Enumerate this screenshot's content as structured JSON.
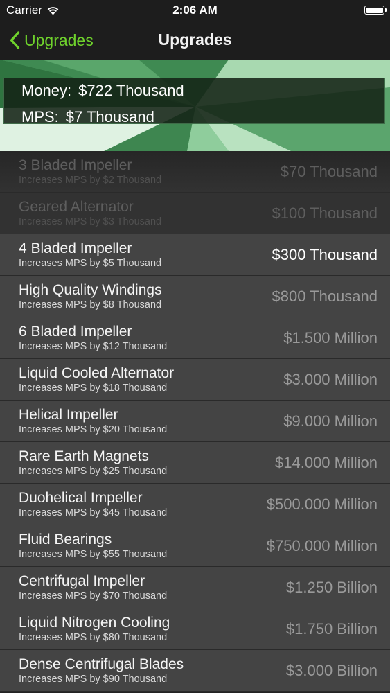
{
  "status_bar": {
    "carrier": "Carrier",
    "time": "2:06 AM",
    "icons": [
      "wifi-icon",
      "battery-icon"
    ]
  },
  "nav": {
    "back_label": "Upgrades",
    "title": "Upgrades",
    "accent_color": "#6fd22c"
  },
  "stats": {
    "money_label": "Money:",
    "money_value": "$722 Thousand",
    "mps_label": "MPS:",
    "mps_value": "$7 Thousand"
  },
  "upgrades": [
    {
      "name": "3 Bladed Impeller",
      "desc": "Increases MPS by $2 Thousand",
      "price": "$70 Thousand",
      "state": "purchased"
    },
    {
      "name": "Geared Alternator",
      "desc": "Increases MPS by $3 Thousand",
      "price": "$100 Thousand",
      "state": "purchased"
    },
    {
      "name": "4 Bladed Impeller",
      "desc": "Increases MPS by $5 Thousand",
      "price": "$300 Thousand",
      "state": "affordable"
    },
    {
      "name": "High Quality Windings",
      "desc": "Increases MPS by $8 Thousand",
      "price": "$800 Thousand",
      "state": "locked"
    },
    {
      "name": "6 Bladed Impeller",
      "desc": "Increases MPS by $12 Thousand",
      "price": "$1.500 Million",
      "state": "locked"
    },
    {
      "name": "Liquid Cooled Alternator",
      "desc": "Increases MPS by $18 Thousand",
      "price": "$3.000 Million",
      "state": "locked"
    },
    {
      "name": "Helical Impeller",
      "desc": "Increases MPS by $20 Thousand",
      "price": "$9.000 Million",
      "state": "locked"
    },
    {
      "name": "Rare Earth Magnets",
      "desc": "Increases MPS by $25 Thousand",
      "price": "$14.000 Million",
      "state": "locked"
    },
    {
      "name": "Duohelical Impeller",
      "desc": "Increases MPS by $45 Thousand",
      "price": "$500.000 Million",
      "state": "locked"
    },
    {
      "name": "Fluid Bearings",
      "desc": "Increases MPS by $55 Thousand",
      "price": "$750.000 Million",
      "state": "locked"
    },
    {
      "name": "Centrifugal Impeller",
      "desc": "Increases MPS by $70 Thousand",
      "price": "$1.250 Billion",
      "state": "locked"
    },
    {
      "name": "Liquid Nitrogen Cooling",
      "desc": "Increases MPS by $80 Thousand",
      "price": "$1.750 Billion",
      "state": "locked"
    },
    {
      "name": "Dense Centrifugal Blades",
      "desc": "Increases MPS by $90 Thousand",
      "price": "$3.000 Billion",
      "state": "locked"
    }
  ]
}
